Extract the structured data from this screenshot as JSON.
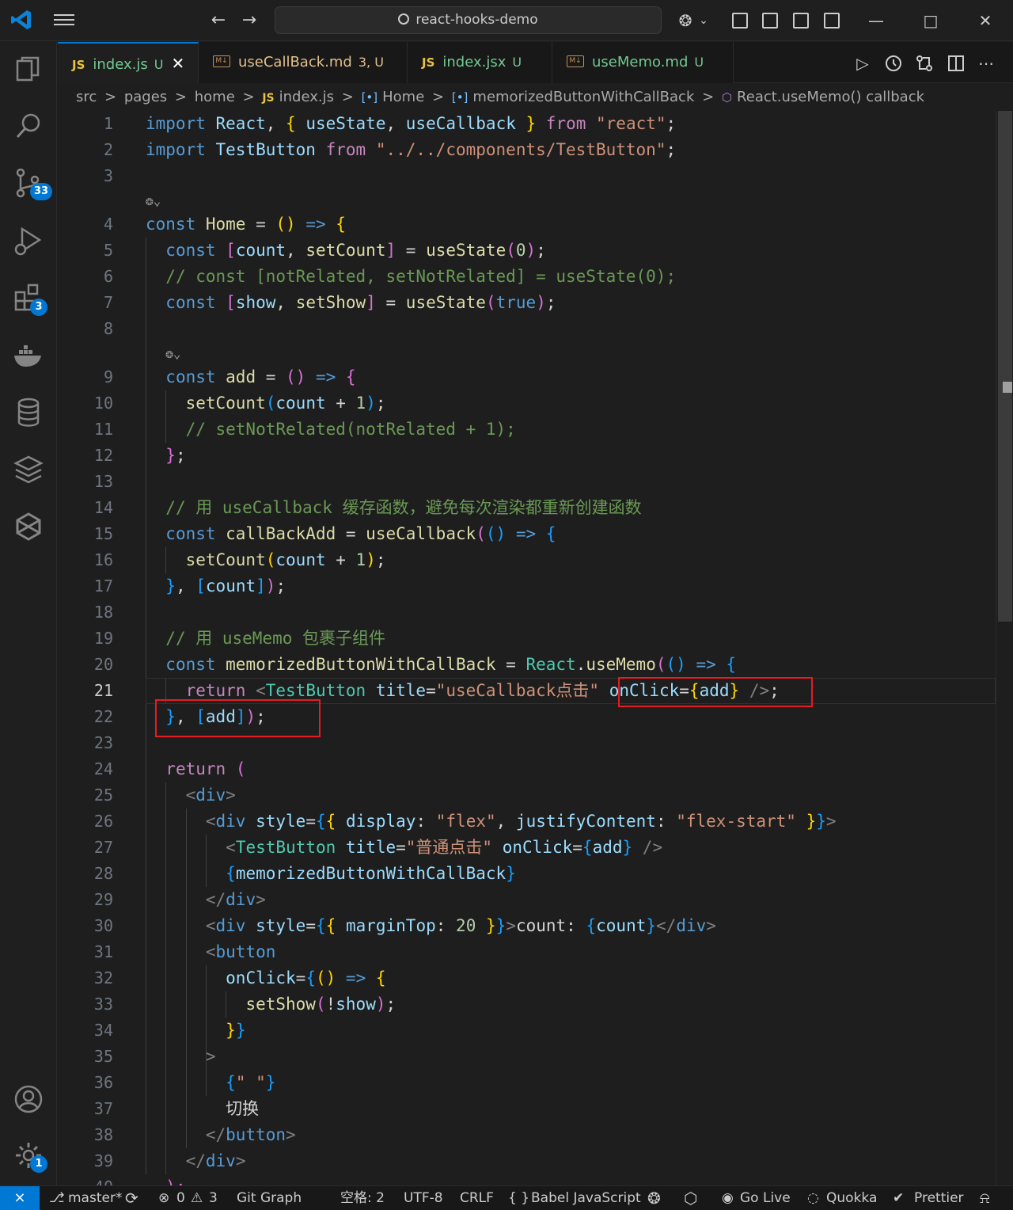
{
  "titlebar": {
    "search_text": "react-hooks-demo",
    "back_glyph": "←",
    "forward_glyph": "→",
    "copilot_glyph": "❂",
    "copilot_chevron": "⌄",
    "minimize_glyph": "—",
    "maximize_glyph": "□",
    "close_glyph": "✕"
  },
  "activity": {
    "source_control_badge": "33",
    "extensions_badge": "3",
    "settings_badge": "1"
  },
  "tabs": [
    {
      "type": "JS",
      "name": "index.js",
      "status": "U",
      "close": "✕"
    },
    {
      "type": "M↓",
      "name": "useCallBack.md",
      "status": "3, U"
    },
    {
      "type": "JS",
      "name": "index.jsx",
      "status": "U"
    },
    {
      "type": "M↓",
      "name": "useMemo.md",
      "status": "U"
    }
  ],
  "tab_actions": {
    "run": "▷",
    "more": "⋯"
  },
  "breadcrumbs": {
    "sep": ">",
    "items": [
      "src",
      "pages",
      "home",
      "index.js",
      "Home",
      "memorizedButtonWithCallBack",
      "React.useMemo() callback"
    ],
    "js_label": "JS",
    "sym_label": "[•]"
  },
  "editor": {
    "current_line": "21",
    "line_numbers": [
      "1",
      "2",
      "3",
      "4",
      "5",
      "6",
      "7",
      "8",
      "9",
      "10",
      "11",
      "12",
      "13",
      "14",
      "15",
      "16",
      "17",
      "18",
      "19",
      "20",
      "21",
      "22",
      "23",
      "24",
      "25",
      "26",
      "27",
      "28",
      "29",
      "30",
      "31",
      "32",
      "33",
      "34",
      "35",
      "36",
      "37",
      "38",
      "39",
      "40"
    ],
    "lens_glyph": "❂⌄",
    "lines": [
      [
        [
          "k",
          "import "
        ],
        [
          "v",
          "React"
        ],
        [
          "w",
          ", "
        ],
        [
          "b1",
          "{ "
        ],
        [
          "v",
          "useState"
        ],
        [
          "w",
          ", "
        ],
        [
          "v",
          "useCallback"
        ],
        [
          "b1",
          " }"
        ],
        [
          "c",
          " from "
        ],
        [
          "s",
          "\"react\""
        ],
        [
          "w",
          ";"
        ]
      ],
      [
        [
          "k",
          "import "
        ],
        [
          "v",
          "TestButton"
        ],
        [
          "c",
          " from "
        ],
        [
          "s",
          "\"../../components/TestButton\""
        ],
        [
          "w",
          ";"
        ]
      ],
      [],
      [
        [
          "k",
          "const "
        ],
        [
          "f",
          "Home"
        ],
        [
          "w",
          " = "
        ],
        [
          "b1",
          "()"
        ],
        [
          "k",
          " => "
        ],
        [
          "b1",
          "{"
        ]
      ],
      [
        [
          "w",
          "  "
        ],
        [
          "k",
          "const "
        ],
        [
          "b2",
          "["
        ],
        [
          "v",
          "count"
        ],
        [
          "w",
          ", "
        ],
        [
          "f",
          "setCount"
        ],
        [
          "b2",
          "]"
        ],
        [
          "w",
          " = "
        ],
        [
          "f",
          "useState"
        ],
        [
          "b2",
          "("
        ],
        [
          "n",
          "0"
        ],
        [
          "b2",
          ")"
        ],
        [
          "w",
          ";"
        ]
      ],
      [
        [
          "w",
          "  "
        ],
        [
          "cm",
          "// const [notRelated, setNotRelated] = useState(0);"
        ]
      ],
      [
        [
          "w",
          "  "
        ],
        [
          "k",
          "const "
        ],
        [
          "b2",
          "["
        ],
        [
          "v",
          "show"
        ],
        [
          "w",
          ", "
        ],
        [
          "f",
          "setShow"
        ],
        [
          "b2",
          "]"
        ],
        [
          "w",
          " = "
        ],
        [
          "f",
          "useState"
        ],
        [
          "b2",
          "("
        ],
        [
          "k",
          "true"
        ],
        [
          "b2",
          ")"
        ],
        [
          "w",
          ";"
        ]
      ],
      [],
      [
        [
          "w",
          "  "
        ],
        [
          "k",
          "const "
        ],
        [
          "f",
          "add"
        ],
        [
          "w",
          " = "
        ],
        [
          "b2",
          "()"
        ],
        [
          "k",
          " => "
        ],
        [
          "b2",
          "{"
        ]
      ],
      [
        [
          "w",
          "    "
        ],
        [
          "f",
          "setCount"
        ],
        [
          "b3",
          "("
        ],
        [
          "v",
          "count"
        ],
        [
          "w",
          " + "
        ],
        [
          "n",
          "1"
        ],
        [
          "b3",
          ")"
        ],
        [
          "w",
          ";"
        ]
      ],
      [
        [
          "w",
          "    "
        ],
        [
          "cm",
          "// setNotRelated(notRelated + 1);"
        ]
      ],
      [
        [
          "w",
          "  "
        ],
        [
          "b2",
          "}"
        ],
        [
          "w",
          ";"
        ]
      ],
      [],
      [
        [
          "w",
          "  "
        ],
        [
          "cm",
          "// 用 useCallback 缓存函数，避免每次渲染都重新创建函数"
        ]
      ],
      [
        [
          "w",
          "  "
        ],
        [
          "k",
          "const "
        ],
        [
          "f",
          "callBackAdd"
        ],
        [
          "w",
          " = "
        ],
        [
          "f",
          "useCallback"
        ],
        [
          "b2",
          "("
        ],
        [
          "b3",
          "()"
        ],
        [
          "k",
          " => "
        ],
        [
          "b3",
          "{"
        ]
      ],
      [
        [
          "w",
          "    "
        ],
        [
          "f",
          "setCount"
        ],
        [
          "b1",
          "("
        ],
        [
          "v",
          "count"
        ],
        [
          "w",
          " + "
        ],
        [
          "n",
          "1"
        ],
        [
          "b1",
          ")"
        ],
        [
          "w",
          ";"
        ]
      ],
      [
        [
          "w",
          "  "
        ],
        [
          "b3",
          "}"
        ],
        [
          "w",
          ", "
        ],
        [
          "b3",
          "["
        ],
        [
          "v",
          "count"
        ],
        [
          "b3",
          "]"
        ],
        [
          "b2",
          ")"
        ],
        [
          "w",
          ";"
        ]
      ],
      [],
      [
        [
          "w",
          "  "
        ],
        [
          "cm",
          "// 用 useMemo 包裹子组件"
        ]
      ],
      [
        [
          "w",
          "  "
        ],
        [
          "k",
          "const "
        ],
        [
          "f",
          "memorizedButtonWithCallBack"
        ],
        [
          "w",
          " = "
        ],
        [
          "t",
          "React"
        ],
        [
          "w",
          "."
        ],
        [
          "f",
          "useMemo"
        ],
        [
          "b2",
          "("
        ],
        [
          "b3",
          "()"
        ],
        [
          "k",
          " => "
        ],
        [
          "b3",
          "{"
        ]
      ],
      [
        [
          "w",
          "    "
        ],
        [
          "c",
          "return "
        ],
        [
          "p",
          "<"
        ],
        [
          "t",
          "TestButton"
        ],
        [
          "w",
          " "
        ],
        [
          "v",
          "title"
        ],
        [
          "w",
          "="
        ],
        [
          "s",
          "\"useCallback点击\""
        ],
        [
          "w",
          " "
        ],
        [
          "v",
          "onClick"
        ],
        [
          "w",
          "="
        ],
        [
          "b1",
          "{"
        ],
        [
          "v",
          "add"
        ],
        [
          "b1",
          "}"
        ],
        [
          "p",
          " />"
        ],
        [
          "w",
          ";"
        ]
      ],
      [
        [
          "w",
          "  "
        ],
        [
          "b3",
          "}"
        ],
        [
          "w",
          ", "
        ],
        [
          "b3",
          "["
        ],
        [
          "v",
          "add"
        ],
        [
          "b3",
          "]"
        ],
        [
          "b2",
          ")"
        ],
        [
          "w",
          ";"
        ]
      ],
      [],
      [
        [
          "w",
          "  "
        ],
        [
          "c",
          "return "
        ],
        [
          "b2",
          "("
        ]
      ],
      [
        [
          "w",
          "    "
        ],
        [
          "p",
          "<"
        ],
        [
          "k",
          "div"
        ],
        [
          "p",
          ">"
        ]
      ],
      [
        [
          "w",
          "      "
        ],
        [
          "p",
          "<"
        ],
        [
          "k",
          "div"
        ],
        [
          "w",
          " "
        ],
        [
          "v",
          "style"
        ],
        [
          "w",
          "="
        ],
        [
          "b3",
          "{"
        ],
        [
          "b1",
          "{"
        ],
        [
          "w",
          " "
        ],
        [
          "v",
          "display"
        ],
        [
          "w",
          ": "
        ],
        [
          "s",
          "\"flex\""
        ],
        [
          "w",
          ", "
        ],
        [
          "v",
          "justifyContent"
        ],
        [
          "w",
          ": "
        ],
        [
          "s",
          "\"flex-start\""
        ],
        [
          "w",
          " "
        ],
        [
          "b1",
          "}"
        ],
        [
          "b3",
          "}"
        ],
        [
          "p",
          ">"
        ]
      ],
      [
        [
          "w",
          "        "
        ],
        [
          "p",
          "<"
        ],
        [
          "t",
          "TestButton"
        ],
        [
          "w",
          " "
        ],
        [
          "v",
          "title"
        ],
        [
          "w",
          "="
        ],
        [
          "s",
          "\"普通点击\""
        ],
        [
          "w",
          " "
        ],
        [
          "v",
          "onClick"
        ],
        [
          "w",
          "="
        ],
        [
          "b3",
          "{"
        ],
        [
          "v",
          "add"
        ],
        [
          "b3",
          "}"
        ],
        [
          "p",
          " />"
        ]
      ],
      [
        [
          "w",
          "        "
        ],
        [
          "b3",
          "{"
        ],
        [
          "v",
          "memorizedButtonWithCallBack"
        ],
        [
          "b3",
          "}"
        ]
      ],
      [
        [
          "w",
          "      "
        ],
        [
          "p",
          "</"
        ],
        [
          "k",
          "div"
        ],
        [
          "p",
          ">"
        ]
      ],
      [
        [
          "w",
          "      "
        ],
        [
          "p",
          "<"
        ],
        [
          "k",
          "div"
        ],
        [
          "w",
          " "
        ],
        [
          "v",
          "style"
        ],
        [
          "w",
          "="
        ],
        [
          "b3",
          "{"
        ],
        [
          "b1",
          "{"
        ],
        [
          "w",
          " "
        ],
        [
          "v",
          "marginTop"
        ],
        [
          "w",
          ": "
        ],
        [
          "n",
          "20"
        ],
        [
          "w",
          " "
        ],
        [
          "b1",
          "}"
        ],
        [
          "b3",
          "}"
        ],
        [
          "p",
          ">"
        ],
        [
          "w",
          "count: "
        ],
        [
          "b3",
          "{"
        ],
        [
          "v",
          "count"
        ],
        [
          "b3",
          "}"
        ],
        [
          "p",
          "</"
        ],
        [
          "k",
          "div"
        ],
        [
          "p",
          ">"
        ]
      ],
      [
        [
          "w",
          "      "
        ],
        [
          "p",
          "<"
        ],
        [
          "k",
          "button"
        ]
      ],
      [
        [
          "w",
          "        "
        ],
        [
          "v",
          "onClick"
        ],
        [
          "w",
          "="
        ],
        [
          "b3",
          "{"
        ],
        [
          "b1",
          "()"
        ],
        [
          "k",
          " => "
        ],
        [
          "b1",
          "{"
        ]
      ],
      [
        [
          "w",
          "          "
        ],
        [
          "f",
          "setShow"
        ],
        [
          "b2",
          "("
        ],
        [
          "w",
          "!"
        ],
        [
          "v",
          "show"
        ],
        [
          "b2",
          ")"
        ],
        [
          "w",
          ";"
        ]
      ],
      [
        [
          "w",
          "        "
        ],
        [
          "b1",
          "}"
        ],
        [
          "b3",
          "}"
        ]
      ],
      [
        [
          "w",
          "      "
        ],
        [
          "p",
          ">"
        ]
      ],
      [
        [
          "w",
          "        "
        ],
        [
          "b3",
          "{"
        ],
        [
          "s",
          "\" \""
        ],
        [
          "b3",
          "}"
        ]
      ],
      [
        [
          "w",
          "        切换"
        ]
      ],
      [
        [
          "w",
          "      "
        ],
        [
          "p",
          "</"
        ],
        [
          "k",
          "button"
        ],
        [
          "p",
          ">"
        ]
      ],
      [
        [
          "w",
          "    "
        ],
        [
          "p",
          "</"
        ],
        [
          "k",
          "div"
        ],
        [
          "p",
          ">"
        ]
      ],
      [
        [
          "w",
          "  "
        ],
        [
          "b2",
          ");"
        ]
      ]
    ]
  },
  "statusbar": {
    "remote": "⨯",
    "branch_glyph": "⎇",
    "branch": "master*",
    "sync": "⟳",
    "errors_glyph": "⊗",
    "errors": "0",
    "warnings_glyph": "⚠",
    "warnings": "3",
    "git_graph": "Git Graph",
    "spaces": "空格: 2",
    "encoding": "UTF-8",
    "eol": "CRLF",
    "language_glyph": "{ }",
    "language": "Babel JavaScript",
    "golive_glyph": "◉",
    "golive": "Go Live",
    "quokka_glyph": "◌",
    "quokka": "Quokka",
    "prettier_glyph": "✔",
    "prettier": "Prettier",
    "bell": "⍾"
  }
}
